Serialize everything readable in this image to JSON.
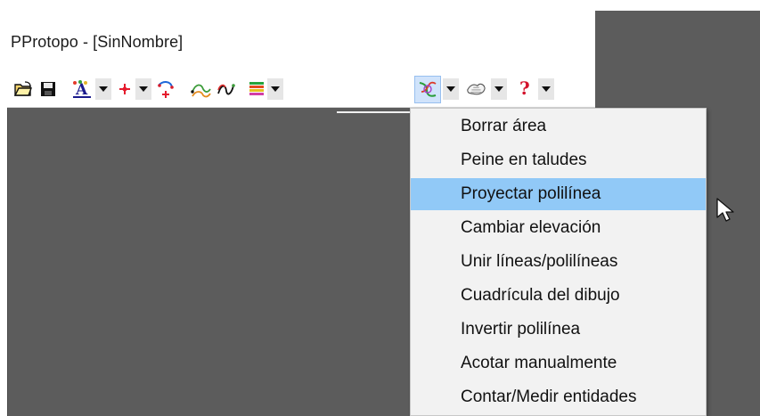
{
  "window": {
    "title": "PProtopo - [SinNombre]"
  },
  "toolbar": {
    "icons": [
      "open-file-icon",
      "save-icon",
      "text-style-icon",
      "point-icon",
      "curve-point-icon",
      "contour-icon",
      "polyline-icon",
      "color-layers-icon",
      "polyline-tools-icon",
      "surface-icon",
      "help-icon"
    ],
    "help_glyph": "?",
    "text_style_glyph": "A"
  },
  "menu": {
    "items": [
      "Borrar área",
      "Peine en taludes",
      "Proyectar polilínea",
      "Cambiar elevación",
      "Unir líneas/polilíneas",
      "Cuadrícula del dibujo",
      "Invertir polilínea",
      "Acotar manualmente",
      "Contar/Medir entidades"
    ],
    "highlighted_item": "Proyectar polilínea"
  },
  "colors": {
    "canvas": "#5c5c5c",
    "menu_background": "#f2f2f2",
    "menu_highlight": "#91c9f7",
    "toolbar_dropdown": "#e6e6e6",
    "selected_button": "#d0e3fb"
  }
}
